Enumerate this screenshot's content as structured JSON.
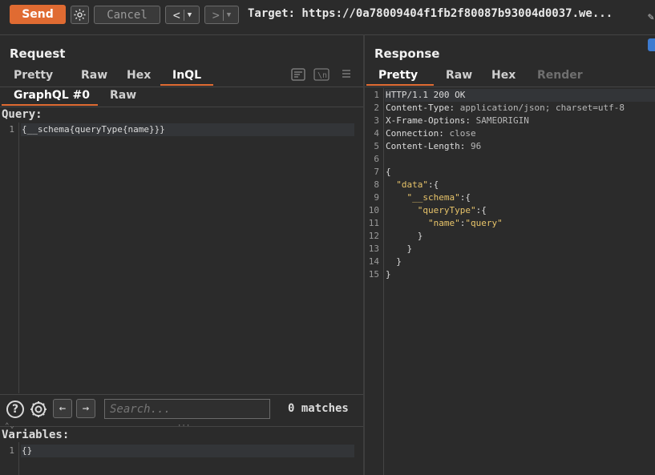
{
  "toolbar": {
    "send_label": "Send",
    "cancel_label": "Cancel",
    "back_label": "<",
    "forward_label": ">",
    "target_text": "Target: https://0a78009404f1fb2f80087b93004d0037.we..."
  },
  "request": {
    "title": "Request",
    "tabs": [
      "Pretty",
      "Raw",
      "Hex",
      "InQL"
    ],
    "subtabs": [
      "GraphQL #0",
      "Raw"
    ],
    "query_label": "Query:",
    "query_lines": [
      "{__schema{queryType{name}}}"
    ],
    "search_placeholder": "Search...",
    "matches_text": "0 matches",
    "variables_label": "Variables:",
    "variables_lines": [
      "{}"
    ],
    "tool_icons": [
      "wrap-icon",
      "newline-icon",
      "menu-icon"
    ]
  },
  "response": {
    "title": "Response",
    "tabs": [
      "Pretty",
      "Raw",
      "Hex",
      "Render"
    ],
    "status_line": "HTTP/1.1 200 OK",
    "headers": [
      {
        "name": "Content-Type",
        "value": "application/json; charset=utf-8"
      },
      {
        "name": "X-Frame-Options",
        "value": "SAMEORIGIN"
      },
      {
        "name": "Connection",
        "value": "close"
      },
      {
        "name": "Content-Length",
        "value": "96"
      }
    ],
    "body_lines": [
      "{",
      "  \"data\":{",
      "    \"__schema\":{",
      "      \"queryType\":{",
      "        \"name\":\"query\"",
      "      }",
      "    }",
      "  }",
      "}"
    ],
    "line_numbers": [
      "1",
      "2",
      "3",
      "4",
      "5",
      "6",
      "7",
      "8",
      "9",
      "10",
      "11",
      "12",
      "13",
      "14",
      "15"
    ]
  },
  "colors": {
    "accent": "#e06b32",
    "background": "#2b2b2b",
    "json_key": "#e8c46a"
  }
}
